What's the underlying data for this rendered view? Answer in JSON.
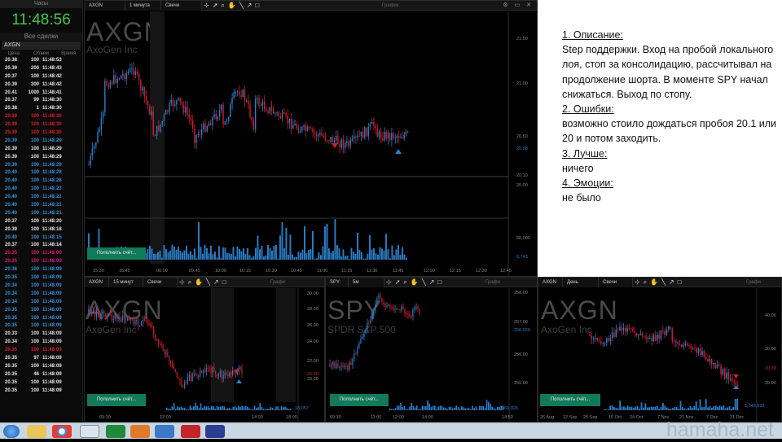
{
  "left": {
    "clock_header": "Часы",
    "clock": "11:48:56",
    "trades_title": "Все сделки",
    "symbol": "AXGN",
    "columns": [
      "Цена",
      "Объем",
      "Время"
    ],
    "trades": [
      [
        "20.38",
        "100",
        "11:48:53",
        "w"
      ],
      [
        "20.39",
        "200",
        "11:48:43",
        "w"
      ],
      [
        "20.37",
        "100",
        "11:48:42",
        "w"
      ],
      [
        "20.39",
        "300",
        "11:48:42",
        "w"
      ],
      [
        "20.41",
        "1000",
        "11:48:41",
        "w"
      ],
      [
        "20.37",
        "99",
        "11:48:30",
        "w"
      ],
      [
        "20.38",
        "1",
        "11:48:30",
        "w"
      ],
      [
        "20.39",
        "100",
        "11:48:30",
        "r"
      ],
      [
        "20.39",
        "100",
        "11:48:30",
        "r"
      ],
      [
        "20.39",
        "100",
        "11:48:30",
        "r"
      ],
      [
        "20.39",
        "100",
        "11:48:29",
        "b"
      ],
      [
        "20.39",
        "100",
        "11:48:29",
        "w"
      ],
      [
        "20.39",
        "100",
        "11:48:29",
        "w"
      ],
      [
        "20.39",
        "100",
        "11:48:29",
        "b"
      ],
      [
        "20.40",
        "100",
        "11:48:28",
        "b"
      ],
      [
        "20.40",
        "100",
        "11:48:28",
        "b"
      ],
      [
        "20.40",
        "100",
        "11:48:23",
        "b"
      ],
      [
        "20.40",
        "100",
        "11:48:21",
        "b"
      ],
      [
        "20.40",
        "100",
        "11:48:21",
        "b"
      ],
      [
        "20.40",
        "100",
        "11:48:21",
        "b"
      ],
      [
        "20.37",
        "100",
        "11:48:20",
        "w"
      ],
      [
        "20.39",
        "100",
        "11:48:18",
        "w"
      ],
      [
        "20.40",
        "100",
        "11:48:15",
        "b"
      ],
      [
        "20.37",
        "100",
        "11:48:14",
        "w"
      ],
      [
        "20.35",
        "100",
        "11:48:09",
        "p"
      ],
      [
        "20.35",
        "100",
        "11:48:09",
        "p"
      ],
      [
        "20.36",
        "100",
        "11:48:09",
        "b"
      ],
      [
        "20.35",
        "100",
        "11:48:09",
        "b"
      ],
      [
        "20.34",
        "100",
        "11:48:09",
        "b"
      ],
      [
        "20.34",
        "100",
        "11:48:09",
        "b"
      ],
      [
        "20.34",
        "100",
        "11:48:09",
        "b"
      ],
      [
        "20.35",
        "100",
        "11:48:09",
        "b"
      ],
      [
        "20.35",
        "100",
        "11:48:09",
        "b"
      ],
      [
        "20.35",
        "100",
        "11:48:09",
        "b"
      ],
      [
        "20.33",
        "100",
        "11:48:09",
        "w"
      ],
      [
        "20.34",
        "100",
        "11:48:09",
        "w"
      ],
      [
        "20.35",
        "100",
        "11:48:09",
        "r"
      ],
      [
        "20.35",
        "97",
        "11:48:09",
        "w"
      ],
      [
        "20.35",
        "100",
        "11:48:09",
        "w"
      ],
      [
        "20.35",
        "46",
        "11:48:09",
        "w"
      ],
      [
        "20.35",
        "100",
        "11:48:09",
        "w"
      ],
      [
        "20.35",
        "100",
        "11:48:09",
        "w"
      ]
    ]
  },
  "main_chart": {
    "symbol": "AXGN",
    "interval": "1 минута",
    "chart_type": "Свечи",
    "graph_title": "График",
    "watermark": "AXGN",
    "watermark_sub": "AxoGen Inc",
    "price_labels": [
      "21.50",
      "21.00",
      "20.50",
      "20.38",
      "20.10",
      "20.00"
    ],
    "volume_labels": [
      "50,000",
      "6,743"
    ],
    "time_labels": [
      "15:30",
      "15:45",
      "00:00",
      "09:45",
      "10:00",
      "10:15",
      "10:30",
      "10:45",
      "11:00",
      "11:15",
      "11:30",
      "11:45",
      "12:00",
      "12:15",
      "12:30",
      "12:45"
    ],
    "deposit_button": "Пополнить счёт..."
  },
  "notes": {
    "h1": "1. Описание:",
    "p1": "Step поддержки. Вход на пробой локального лоя, стоп за консолидацию, рассчитывал на продолжение шорта. В моменте SPY начал снижаться. Выход по стопу.",
    "h2": "2. Ошибки:",
    "p2": "возможно стоило дождаться пробоя 20.1 или 20 и потом заходить.",
    "h3": "3. Лучше:",
    "p3": "ничего",
    "h4": "4. Эмоции:",
    "p4": "не было"
  },
  "chart2": {
    "symbol": "AXGN",
    "interval": "15 минут",
    "chart_type": "Свечи",
    "graph_title": "Графи",
    "watermark": "AXGN",
    "watermark_sub": "AxoGen Inc",
    "price_labels": [
      "30.00",
      "28.00",
      "26.00",
      "24.00",
      "22.00",
      "20.38",
      "20.00"
    ],
    "volume_label": "18,057",
    "time_labels": [
      "09:30",
      "12:00",
      "14:00",
      "18:00"
    ],
    "deposit_button": "Пополнить счёт..."
  },
  "chart3": {
    "symbol": "SPY",
    "interval": "5м",
    "graph_title": "Графи",
    "watermark": "SPY",
    "watermark_sub": "SPDR S&P 500",
    "price_labels": [
      "258.00",
      "257.00",
      "256.026",
      "256.00",
      "255.00"
    ],
    "volume_label": "569,026",
    "time_labels": [
      "09:30",
      "11:00",
      "12:00",
      "14:00",
      "14:50"
    ],
    "deposit_button": "Пополнить счёт..."
  },
  "chart4": {
    "symbol": "AXGN",
    "interval": "День",
    "chart_type": "Свечи",
    "graph_title": "Графи",
    "watermark": "AXGN",
    "watermark_sub": "AxoGen Inc",
    "price_labels": [
      "40.00",
      "30.00",
      "20.38",
      "20.00"
    ],
    "volume_label": "1,048,593",
    "time_labels": [
      "26 Aug",
      "12 Sep",
      "26 Sep",
      "10 Oct",
      "24 Oct",
      "7 Nov",
      "21 Nov",
      "7 Dec",
      "21 Dec"
    ],
    "deposit_button": "Пополнить счёт..."
  },
  "taskbar": {
    "watermark": "hamaha.net"
  },
  "colors": {
    "bull": "#2a7fc9",
    "bear": "#d0202a",
    "clock": "#48c44a",
    "deposit": "#12795a"
  }
}
